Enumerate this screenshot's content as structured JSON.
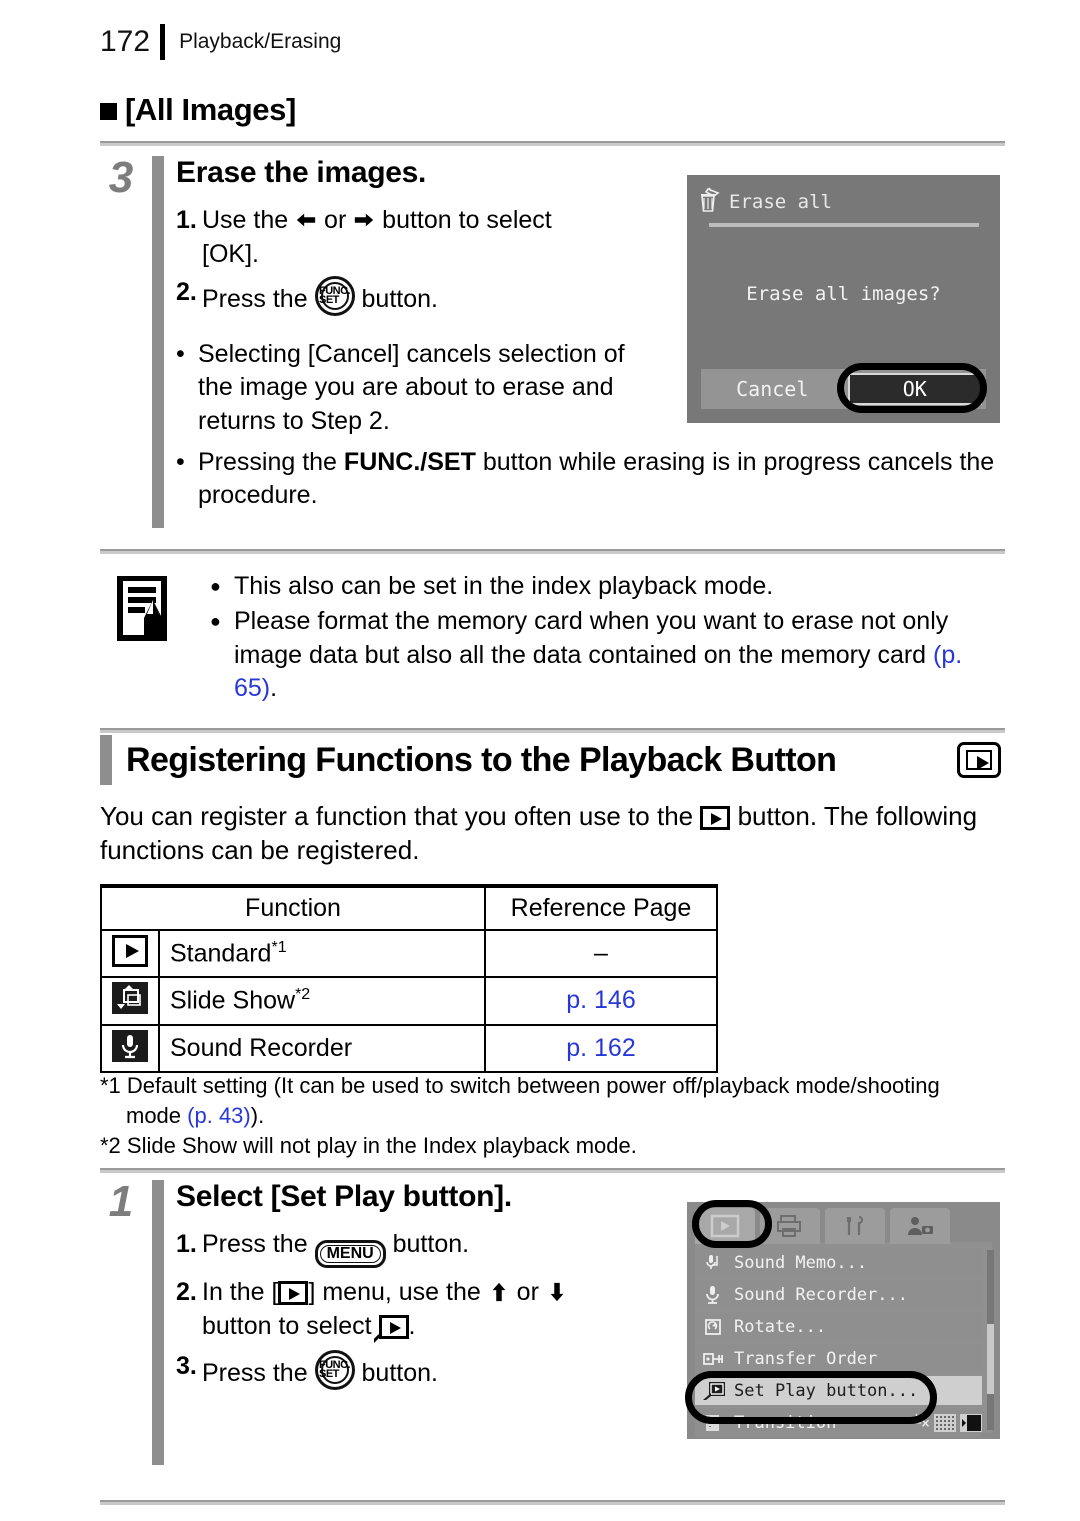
{
  "header": {
    "page_number": "172",
    "section": "Playback/Erasing"
  },
  "all_images_heading": "[All Images]",
  "step3": {
    "number": "3",
    "title": "Erase the images.",
    "ordered": [
      {
        "n": "1.",
        "pre": "Use the ",
        "mid": " or ",
        "post": " button to select",
        "cont": "[OK]."
      },
      {
        "n": "2.",
        "pre": "Press the ",
        "post": " button."
      }
    ],
    "bullets": [
      "Selecting [Cancel] cancels selection of the image you are about to erase and returns to Step 2.",
      "Pressing the FUNC./SET button while erasing is in progress cancels the procedure."
    ],
    "bullet2_parts": {
      "a": "Pressing the ",
      "b": "FUNC./SET",
      "c": " button while erasing is in progress cancels the procedure."
    }
  },
  "lcd_erase": {
    "icon": "erase-all-icon",
    "title": "Erase all",
    "message": "Erase all images?",
    "cancel_label": "Cancel",
    "ok_label": "OK",
    "bg_color": "#787878",
    "highlighted": "OK"
  },
  "note": {
    "icon": "memo-note-icon",
    "items": [
      {
        "text": "This also can be set in the index playback mode."
      },
      {
        "pre": "Please format the memory card when you want to erase not only image data but also all the data contained on the memory card ",
        "ref": "(p. 65)",
        "post": "."
      }
    ]
  },
  "section": {
    "title": "Registering Functions to the Playback Button",
    "icon": "playback-button-icon",
    "intro_a": "You can register a function that you often use to the ",
    "intro_b": " button. The following functions can be registered."
  },
  "table": {
    "headers": [
      "Function",
      "Reference Page"
    ],
    "rows": [
      {
        "icon": "playback-icon",
        "name": "Standard",
        "footnote": "*1",
        "page": "–",
        "page_is_link": false
      },
      {
        "icon": "slide-show-icon",
        "name": "Slide Show",
        "footnote": "*2",
        "page": "p. 146",
        "page_is_link": true
      },
      {
        "icon": "sound-recorder-icon",
        "name": "Sound Recorder",
        "footnote": "",
        "page": "p. 162",
        "page_is_link": true
      }
    ]
  },
  "footnotes": {
    "f1_a": "*1 Default setting (It can be used to switch between power off/playback mode/shooting",
    "f1_b": "mode ",
    "f1_ref": "(p. 43)",
    "f1_c": ").",
    "f2": "*2 Slide Show will not play in the Index playback mode."
  },
  "step1": {
    "number": "1",
    "title": "Select [Set Play button].",
    "items": [
      {
        "n": "1.",
        "pre": "Press the ",
        "btn": "MENU",
        "post": " button."
      },
      {
        "n": "2.",
        "pre": "In the [",
        "post": "] menu, use the ",
        "mid": " or ",
        "cont_pre": "button to select ",
        "cont_post": "."
      },
      {
        "n": "3.",
        "pre": "Press the ",
        "post": " button."
      }
    ]
  },
  "lcd_menu": {
    "tabs": [
      "playback-tab",
      "print-tab",
      "settings-tab",
      "my-camera-tab"
    ],
    "selected_tab": "playback-tab",
    "items": [
      {
        "icon": "sound-memo-icon",
        "label": "Sound Memo...",
        "selected": false
      },
      {
        "icon": "sound-recorder-icon",
        "label": "Sound Recorder...",
        "selected": false
      },
      {
        "icon": "rotate-icon",
        "label": "Rotate...",
        "selected": false
      },
      {
        "icon": "transfer-order-icon",
        "label": "Transfer Order",
        "selected": false
      },
      {
        "icon": "set-play-button-icon",
        "label": "Set Play button...",
        "selected": true
      },
      {
        "icon": "transition-icon",
        "label": "Transition",
        "selected": false
      }
    ],
    "highlighted": "Set Play button..."
  },
  "colors": {
    "link": "#2738d8",
    "step_gray": "#7d7d7d",
    "bar_gray": "#8e8e8e",
    "lcd_bg": "#787878",
    "lcd_menu_bg": "#8a8a8a"
  }
}
